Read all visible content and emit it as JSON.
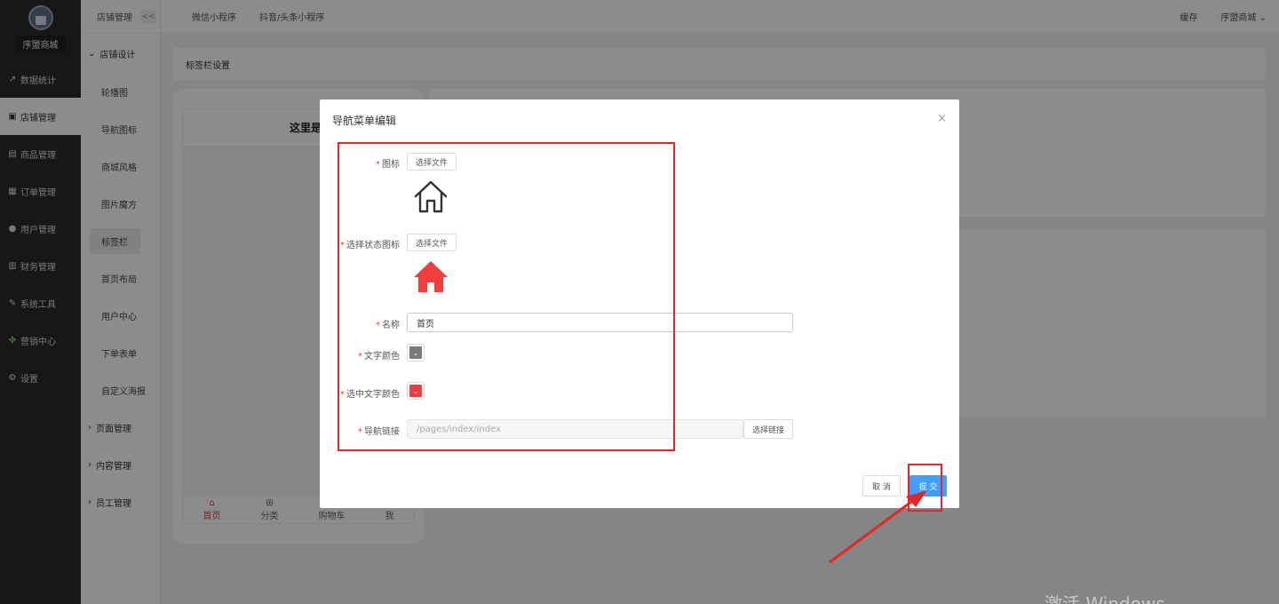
{
  "sidebar": {
    "shop_name": "序盟商城",
    "items": [
      {
        "label": "数据统计",
        "icon": "chart-line-icon"
      },
      {
        "label": "店铺管理",
        "icon": "shop-icon"
      },
      {
        "label": "商品管理",
        "icon": "box-icon"
      },
      {
        "label": "订单管理",
        "icon": "order-icon"
      },
      {
        "label": "用户管理",
        "icon": "user-icon"
      },
      {
        "label": "财务管理",
        "icon": "wallet-icon"
      },
      {
        "label": "系统工具",
        "icon": "wrench-icon"
      },
      {
        "label": "营销中心",
        "icon": "marketing-icon"
      },
      {
        "label": "设置",
        "icon": "gear-icon"
      }
    ]
  },
  "submenu": {
    "header": "店铺管理",
    "collapse": "<<",
    "group_open": "店铺设计",
    "items": [
      "轮播图",
      "导航图标",
      "商城风格",
      "图片魔方",
      "标签栏",
      "首页布局",
      "用户中心",
      "下单表单",
      "自定义海报"
    ],
    "groups_closed": [
      "页面管理",
      "内容管理",
      "员工管理"
    ]
  },
  "topbar": {
    "tabs": [
      "微信小程序",
      "抖音/头条小程序"
    ],
    "cache": "缓存",
    "account": "序盟商城"
  },
  "content": {
    "breadcrumb": "标签栏设置",
    "phone_title": "这里是标题",
    "tabbar": [
      "首页",
      "分类",
      "购物车",
      "我"
    ]
  },
  "modal": {
    "title": "导航菜单编辑",
    "close": "×",
    "icon_label": "图标",
    "select_file": "选择文件",
    "active_icon_label": "选择状态图标",
    "name_label": "名称",
    "name_value": "首页",
    "text_color_label": "文字颜色",
    "active_text_color_label": "选中文字颜色",
    "link_label": "导航链接",
    "link_placeholder": "/pages/index/index",
    "select_link": "选择链接",
    "cancel": "取 消",
    "submit": "提 交",
    "colors": {
      "text": "#7a7a7a",
      "active_text": "#f23d3d",
      "icon_active": "#f23d3d"
    }
  },
  "watermark": "激活 Windows"
}
